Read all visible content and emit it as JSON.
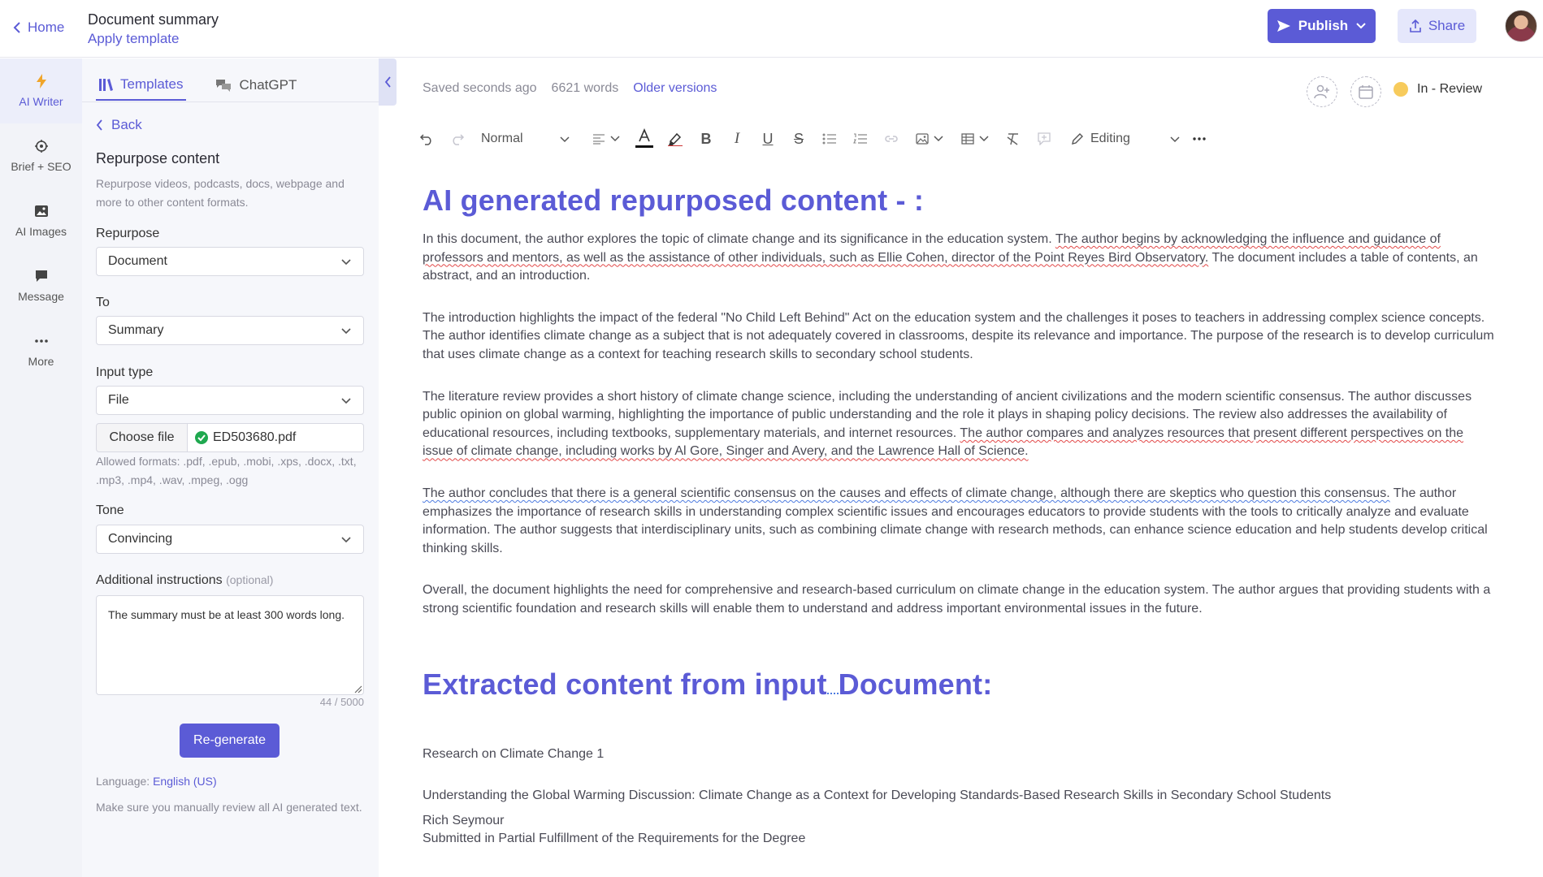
{
  "topbar": {
    "home_label": "Home",
    "doc_title": "Document summary",
    "apply_template": "Apply template",
    "publish_label": "Publish",
    "share_label": "Share"
  },
  "rail": {
    "items": [
      {
        "label": "AI Writer",
        "icon": "bolt-icon"
      },
      {
        "label": "Brief + SEO",
        "icon": "target-icon"
      },
      {
        "label": "AI Images",
        "icon": "image-icon"
      },
      {
        "label": "Message",
        "icon": "message-icon"
      },
      {
        "label": "More",
        "icon": "more-icon"
      }
    ]
  },
  "panel": {
    "tabs": [
      "Templates",
      "ChatGPT"
    ],
    "back_label": "Back",
    "title": "Repurpose content",
    "description": "Repurpose videos, podcasts, docs, webpage and more to other content formats.",
    "repurpose_label": "Repurpose",
    "repurpose_value": "Document",
    "to_label": "To",
    "to_value": "Summary",
    "input_type_label": "Input type",
    "input_type_value": "File",
    "choose_file_label": "Choose file",
    "file_name": "ED503680.pdf",
    "allowed_formats": "Allowed formats: .pdf, .epub, .mobi, .xps, .docx, .txt, .mp3, .mp4, .wav, .mpeg, .ogg",
    "tone_label": "Tone",
    "tone_value": "Convincing",
    "additional_label": "Additional instructions",
    "optional_label": "(optional)",
    "additional_value": "The summary must be at least 300 words long.",
    "counter": "44 / 5000",
    "regenerate_label": "Re-generate",
    "language_label": "Language:",
    "language_value": "English (US)",
    "review_note": "Make sure you manually review all AI generated text."
  },
  "editor": {
    "saved": "Saved seconds ago",
    "word_count": "6621 words",
    "older_versions": "Older versions",
    "status": "In - Review",
    "status_color": "#f7cb5c",
    "style_value": "Normal",
    "editing_mode": "Editing",
    "accent_color": "#5b5bd6"
  },
  "document": {
    "heading1": "AI generated repurposed content - :",
    "p1_a": "  In this document, the author explores the topic of climate change and its significance in the education system. ",
    "p1_b": "The author begins by acknowledging the influence and guidance of professors and mentors, as well as the assistance of other individuals, such as Ellie Cohen, director of the Point Reyes Bird Observatory.",
    "p1_c": " The document includes a table of contents, an abstract, and an introduction.",
    "p2": "The introduction highlights the impact of the federal \"No Child Left Behind\" Act on the education system and the challenges it poses to teachers in addressing complex science concepts. The author identifies climate change as a subject that is not adequately covered in classrooms, despite its relevance and importance. The purpose of the research is to develop curriculum that uses climate change as a context for teaching research skills to secondary school students.",
    "p3_a": "The literature review provides a short history of climate change science, including the understanding of ancient civilizations and the modern scientific consensus. The author discusses public opinion on global warming, highlighting the importance of public understanding and the role it plays in shaping policy decisions. The review also addresses the availability of educational resources, including textbooks, supplementary materials, and internet resources. ",
    "p3_b": "The author compares and analyzes resources that present different perspectives on the issue of climate change, including works by Al Gore, Singer and Avery, and the Lawrence Hall of Science.",
    "p4_a": "The author concludes that there is a general scientific consensus on the causes and effects of climate change, although there are skeptics who question this consensus.",
    "p4_b": " The author emphasizes the importance of research skills in understanding complex scientific issues and encourages educators to provide students with the tools to critically analyze and evaluate information. The author suggests that interdisciplinary units, such as combining climate change with research methods, can enhance science education and help students develop critical thinking skills.",
    "p5": "Overall, the document highlights the need for comprehensive and research-based curriculum on climate change in the education system. The author argues that providing students with a strong scientific foundation and research skills will enable them to understand and address important environmental issues in the future.",
    "heading2_a": "Extracted content from input",
    "heading2_b": "Document:",
    "e1": " Research on Climate Change 1",
    "e2": "Understanding the Global Warming Discussion: Climate Change as a Context for Developing Standards-Based Research Skills in Secondary School Students",
    "e3": "Rich Seymour",
    "e4": "Submitted in Partial Fulfillment of the Requirements for the Degree"
  }
}
